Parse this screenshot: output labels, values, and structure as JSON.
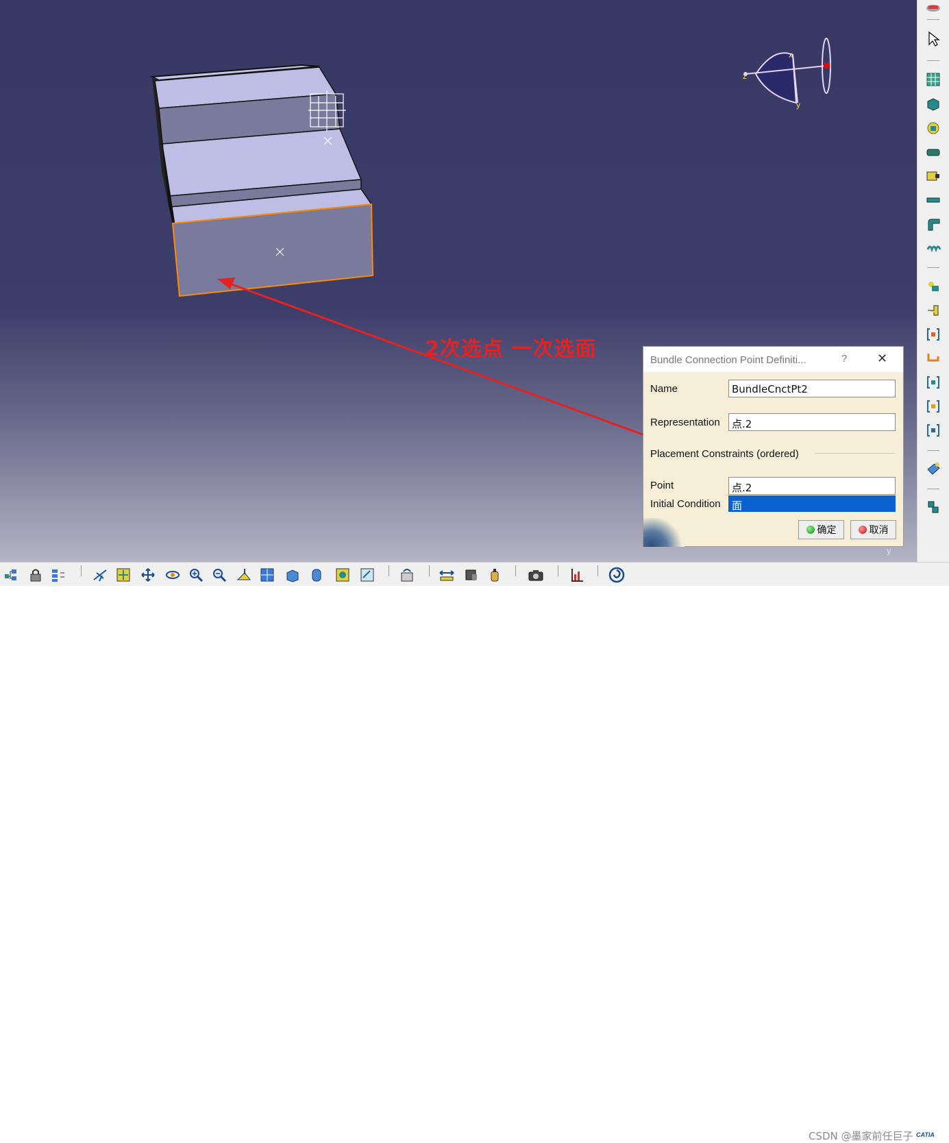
{
  "annotation": {
    "text": "2次选点 一次选面",
    "color": "#e32222"
  },
  "dialog": {
    "title": "Bundle Connection Point Definiti...",
    "help_label": "?",
    "close_label": "✕",
    "name_label": "Name",
    "name_value": "BundleCnctPt2",
    "representation_label": "Representation",
    "representation_value": "点.2",
    "group_label": "Placement Constraints (ordered)",
    "point_label": "Point",
    "point_value": "点.2",
    "initial_condition_label": "Initial Condition",
    "initial_condition_value": "面",
    "ok_label": "确定",
    "cancel_label": "取消"
  },
  "compass": {
    "x_label": "x",
    "y_label": "y",
    "z_label": "z"
  },
  "viewport": {
    "corner_axis_label": "y"
  },
  "watermark": "CSDN @墨家前任巨子",
  "logo_text": "CATIA",
  "colors": {
    "selection": "#ff8a00",
    "accent": "#0a62d0",
    "arrow": "#e32222"
  }
}
